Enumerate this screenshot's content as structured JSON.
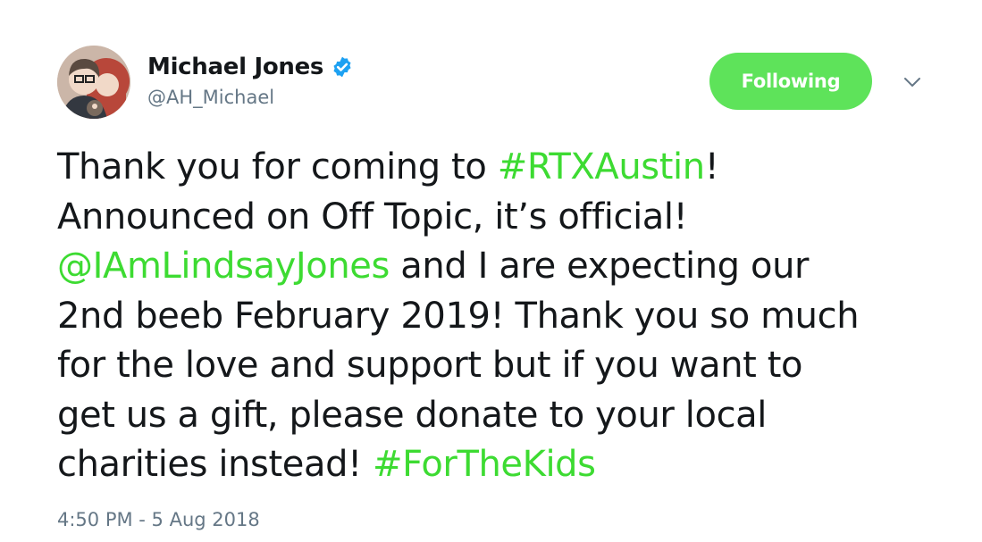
{
  "author": {
    "display_name": "Michael Jones",
    "handle": "@AH_Michael",
    "verified": true
  },
  "follow_button": {
    "label": "Following",
    "color": "#5ee35a"
  },
  "menu_icon": "chevron-down-icon",
  "tweet": {
    "lines": [
      [
        {
          "text": "Thank you for coming to "
        },
        {
          "text": "#RTXAustin",
          "link": true
        },
        {
          "text": "!"
        }
      ],
      [
        {
          "text": "Announced on Off Topic, it’s official!"
        }
      ],
      [
        {
          "text": "@IAmLindsayJones",
          "link": true
        },
        {
          "text": " and I are expecting our"
        }
      ],
      [
        {
          "text": "2nd beeb February 2019! Thank you so much"
        }
      ],
      [
        {
          "text": "for the love and support but if you want to"
        }
      ],
      [
        {
          "text": "get us a gift, please donate to your local"
        }
      ],
      [
        {
          "text": "charities instead! "
        },
        {
          "text": "#ForTheKids",
          "link": true
        }
      ]
    ],
    "link_color": "#3ddb32"
  },
  "timestamp": "4:50 PM - 5 Aug 2018"
}
